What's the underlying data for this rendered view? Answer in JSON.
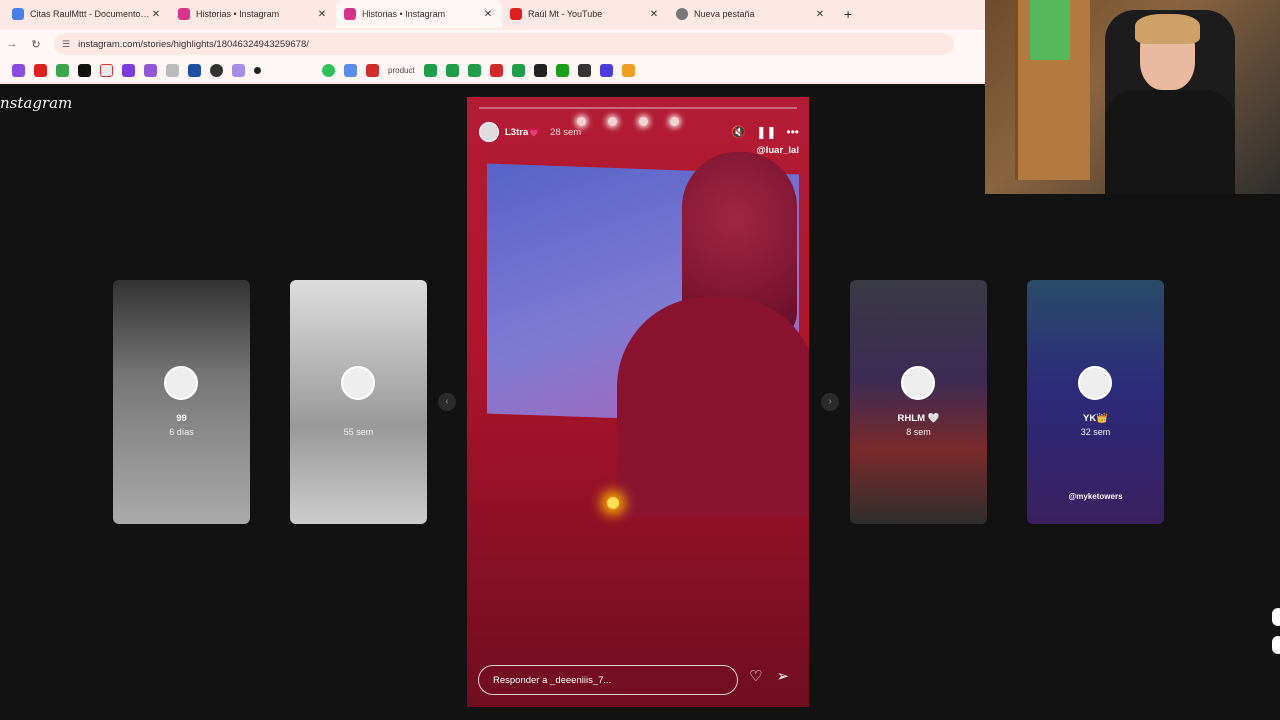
{
  "browser": {
    "tabs": [
      {
        "label": "Citas RaulMttt - Documentos d",
        "icon": "docs-icon",
        "color": "#4a7ee8"
      },
      {
        "label": "Historias • Instagram",
        "icon": "instagram-icon",
        "color": "#d6348b"
      },
      {
        "label": "Historias • Instagram",
        "icon": "instagram-icon",
        "color": "#d6348b",
        "active": true
      },
      {
        "label": "Raúl Mt - YouTube",
        "icon": "youtube-icon",
        "color": "#e02020"
      },
      {
        "label": "Nueva pestaña",
        "icon": "chrome-icon",
        "color": "#777777"
      }
    ],
    "close_glyph": "✕",
    "new_tab_glyph": "+",
    "url": "instagram.com/stories/highlights/18046324943259678/",
    "bookmarks_text": "product"
  },
  "instagram": {
    "logo": "Instagram",
    "story": {
      "username": "L3tra💗",
      "time": "28 sem",
      "mention": "@luar_lal",
      "reply_placeholder": "Responder a _deeeniiis_7..."
    },
    "previews": [
      {
        "name": "99",
        "time": "6 días",
        "tag": ""
      },
      {
        "name": "",
        "time": "55 sem",
        "tag": ""
      },
      {
        "name": "RHLM 🤍",
        "time": "8 sem",
        "tag": ""
      },
      {
        "name": "YK👑",
        "time": "32 sem",
        "tag": "@myketowers"
      }
    ]
  },
  "colors": {
    "accent_story": "#b21c34",
    "browser_chrome": "#fde8e5"
  }
}
